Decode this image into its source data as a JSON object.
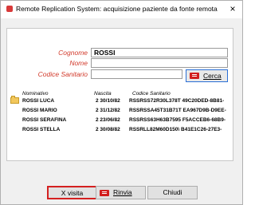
{
  "window": {
    "title": "Remote Replication System: acquisizione paziente da fonte remota",
    "close_glyph": "×"
  },
  "form": {
    "cognome_label": "Cognome",
    "cognome_value": "ROSSI",
    "nome_label": "Nome",
    "nome_value": "",
    "codice_label": "Codice Sanitario",
    "codice_value": "",
    "cerca_label": "Cerca"
  },
  "table": {
    "headers": [
      "Nominativo",
      "Nascita",
      "Codice Sanitario"
    ],
    "rows": [
      {
        "name": "ROSSI LUCA",
        "birth": "2 30/10/82",
        "code": "RSSRSS72R30L378T 49C20DED-8B81-"
      },
      {
        "name": "ROSSI MARIO",
        "birth": "2 31/12/82",
        "code": "RSSRSSA45T31B71T EA967D9B-D9EE-"
      },
      {
        "name": "ROSSI SERAFINA",
        "birth": "2 23/06/82",
        "code": "RSSRSS63H63B7595 F5ACCEB6-68B9-"
      },
      {
        "name": "ROSSI STELLA",
        "birth": "2 30/08/82",
        "code": "RSSRLL82M60D150\\ B41E1C26-27E3-"
      }
    ]
  },
  "buttons": {
    "xvisita": "X visita",
    "rinvia": "Rinvia",
    "chiudi": "Chiudi"
  },
  "colors": {
    "label_red": "#d23a2b",
    "highlight_red": "#d42020",
    "focus_blue": "#2a6fd6"
  },
  "icons": {
    "app": "remote-replication-app-icon",
    "folder": "folder-icon"
  }
}
